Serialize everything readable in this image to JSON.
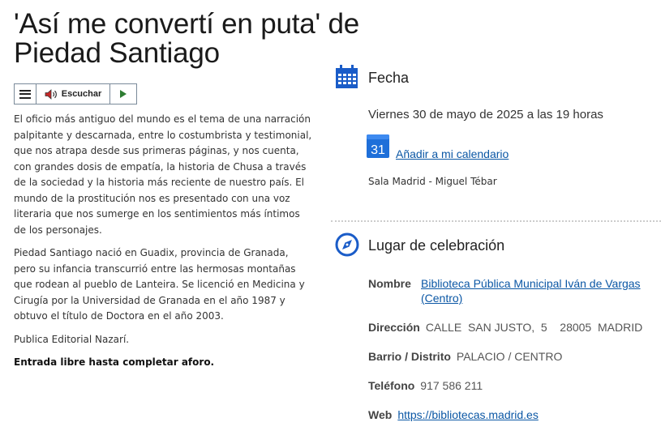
{
  "event": {
    "title": "'Así me convertí en puta' de Piedad Santiago"
  },
  "player": {
    "menu_icon": "hamburger-menu-icon",
    "speaker_icon": "speaker-icon",
    "listen_label": "Escuchar",
    "play_icon": "play-icon"
  },
  "description": {
    "p1": "El oficio más antiguo del mundo es el tema de una narración palpitante y descarnada, entre lo costumbrista y testimonial, que nos atrapa desde sus primeras páginas, y nos cuenta, con grandes dosis de empatía, la historia de Chusa a través de la sociedad y la historia más reciente de nuestro país. El mundo de la prostitución nos es presentado con una voz literaria que nos sumerge en los sentimientos más íntimos de los personajes.",
    "p2": "Piedad Santiago nació en Guadix, provincia de Granada, pero su infancia transcurrió entre las hermosas montañas que rodean al pueblo de Lanteira. Se licenció en Medicina y Cirugía por la Universidad de Granada en el año 1987 y obtuvo el título de Doctora en el año 2003.",
    "p3": "Publica Editorial Nazarí.",
    "p4": "Entrada libre hasta completar aforo."
  },
  "date_section": {
    "heading": "Fecha",
    "icon": "calendar-icon",
    "date_text": "Viernes 30 de mayo de 2025 a las 19 horas",
    "calendar_badge": "31",
    "add_calendar_label": "Añadir a mi calendario",
    "room": "Sala Madrid - Miguel Tébar"
  },
  "venue_section": {
    "heading": "Lugar de celebración",
    "icon": "compass-icon",
    "name_label": "Nombre",
    "name_line1": "Biblioteca Pública Municipal Iván de Vargas",
    "name_line2": "(Centro)",
    "address_label": "Dirección",
    "address_value": "CALLE  SAN JUSTO,  5    28005  MADRID",
    "district_label": "Barrio / Distrito",
    "district_value": "PALACIO / CENTRO",
    "phone_label": "Teléfono",
    "phone_value": "917 586 211",
    "web_label": "Web",
    "web_value": "https://bibliotecas.madrid.es"
  },
  "colors": {
    "accent_blue": "#1a5cc8",
    "link": "#0b57a5",
    "play_green": "#2e7d32"
  }
}
